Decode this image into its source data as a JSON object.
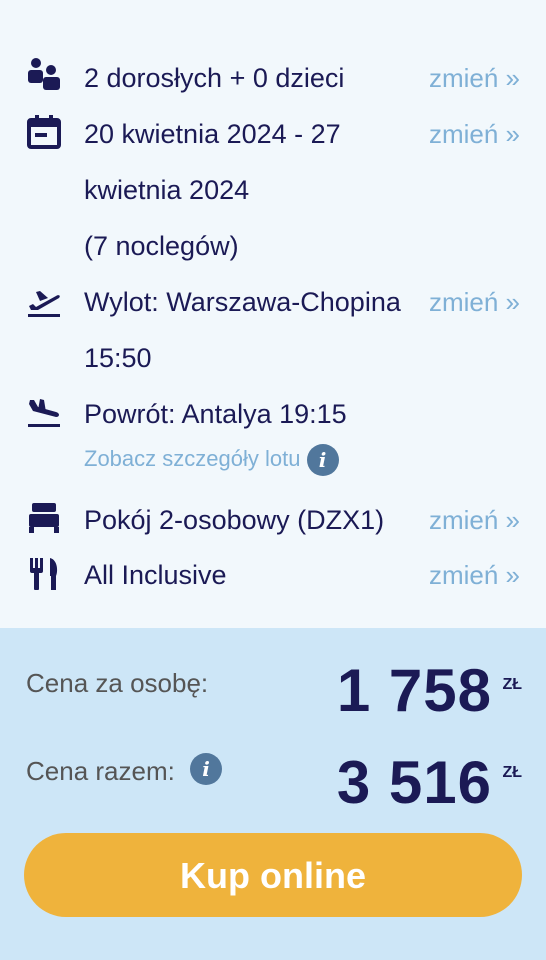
{
  "details": {
    "change_label": "zmień »",
    "travelers": {
      "icon": "people-icon",
      "text": "2 dorosłych + 0 dzieci"
    },
    "dates": {
      "icon": "calendar-icon",
      "line1": "20 kwietnia 2024 - 27",
      "line2": "kwietnia 2024",
      "line3": "(7 noclegów)"
    },
    "departure": {
      "icon": "plane-departure-icon",
      "line1": "Wylot: Warszawa-Chopina",
      "line2": "15:50"
    },
    "return": {
      "icon": "plane-arrival-icon",
      "line1": "Powrót: Antalya 19:15",
      "details_link": "Zobacz szczegóły lotu",
      "info_glyph": "i"
    },
    "room": {
      "icon": "bed-icon",
      "text": "Pokój 2-osobowy (DZX1)"
    },
    "board": {
      "icon": "fork-knife-icon",
      "text": "All Inclusive"
    }
  },
  "pricing": {
    "per_person_label": "Cena za osobę:",
    "per_person_value": "1 758",
    "total_label": "Cena razem:",
    "total_value": "3 516",
    "currency": "ZŁ",
    "info_glyph": "i",
    "buy_label": "Kup online"
  },
  "colors": {
    "primary_text": "#1b1a55",
    "link": "#7fb0d6",
    "panel_bg": "#cde6f7",
    "page_bg": "#f2f8fc",
    "button": "#efb33c",
    "info_badge": "#51779c"
  }
}
